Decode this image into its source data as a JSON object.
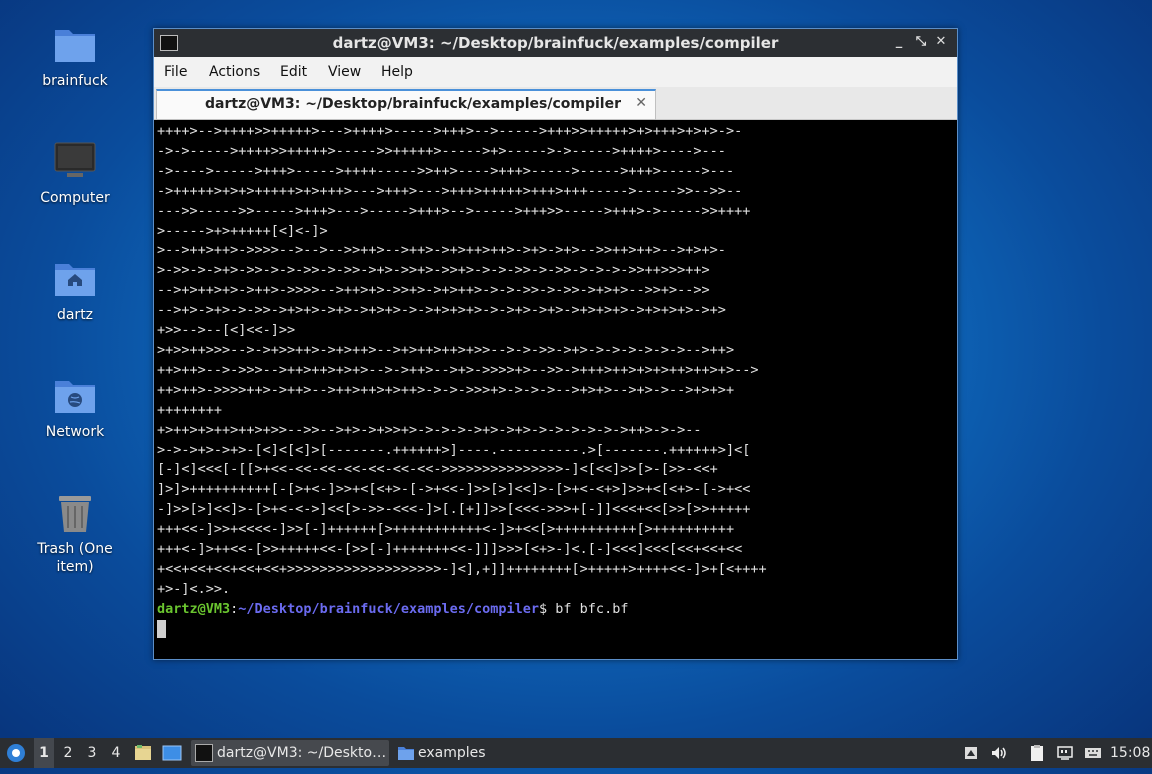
{
  "desktop": {
    "icons": [
      {
        "label": "brainfuck",
        "icon": "folder-icon"
      },
      {
        "label": "Computer",
        "icon": "computer-icon"
      },
      {
        "label": "dartz",
        "icon": "home-folder-icon"
      },
      {
        "label": "Network",
        "icon": "network-icon"
      },
      {
        "label": "Trash (One item)",
        "icon": "trash-icon"
      }
    ]
  },
  "window": {
    "title": "dartz@VM3: ~/Desktop/brainfuck/examples/compiler",
    "controls": {
      "minimize": "_",
      "maximize": "⤡",
      "close": "✕"
    },
    "menu": [
      "File",
      "Actions",
      "Edit",
      "View",
      "Help"
    ],
    "tab": {
      "label": "dartz@VM3: ~/Desktop/brainfuck/examples/compiler",
      "close": "✕"
    }
  },
  "terminal": {
    "lines": [
      "++++>-->++++>>+++++>--->++++>----->+++>-->----->+++>>+++++>+>+++>+>+>->-",
      "->->----->++++>>+++++>----->>+++++>----->+>----->->----->++++>---->---",
      "->---->----->+++>----->++++----->>++>---->+++>----->----->+++>----->---",
      "->+++++>+>+>+++++>+>+++>--->+++>--->+++>+++++>+++>+++----->----->>-->>--",
      "--->>----->>----->+++>--->----->+++>-->----->+++>>----->+++>->----->>++++",
      ">----->+>+++++[<]<-]>",
      ">-->++>++>->>>>-->-->-->>++>-->++>->+>++>++>->+>->+>-->>++>++>-->+>+>-",
      ">->>->->+>->>->->->>->->>->+>->>+>->>+>->->->>->->>->->->->>++>>>++>",
      "-->+>++>+>->++>->>>>-->++>+>->>+>->+>++>->->->>->->>->+>+>-->>+>-->>",
      "-->+>->+>->->>->+>+>->+>->+>+>->->+>+>+>->->+>->+>->+>+>+>->+>+>+>->+>",
      "+>>-->--[<]<<-]>>",
      ">+>>++>>>-->->+>>++>->+>++>-->+>++>++>+>>-->->->>->+>->->->->->->-->++>",
      "++>++>-->->>>-->++>++>+>+>-->->++>-->+>->>>>+>-->>->+++>++>+>+>++>++>+>-->",
      "++>++>->>>>++>->++>-->++>++>+>++>->->->>>+>->->->-->+>+>-->+>->-->+>+>+",
      "++++++++",
      "+>++>+>++>++>+>>-->>-->+>->+>>+>->->->->+>->+>->->->->->->++>->->--",
      ">->->+>->+>-[<]<[<]>[-------.++++++>]----.----------.>[-------.++++++>]<[",
      "[-]<]<<<[-[[>+<<-<<-<<-<<-<<-<<-<<->>>>>>>>>>>>>>>-]<[<<]>>[>-[>>-<<+",
      "]>]>++++++++++[-[>+<-]>>+<[<+>-[->+<<-]>>[>]<<]>-[>+<-<+>]>>+<[<+>-[->+<<",
      "-]>>[>]<<]>-[>+<-<->]<<[>->>-<<<-]>[.[+]]>>[<<<->>>+[-]]<<<+<<[>>[>>+++++",
      "+++<<-]>>+<<<<-]>>[-]++++++[>+++++++++++<-]>+<<[>++++++++++[>++++++++++",
      "+++<-]>++<<-[>>+++++<<-[>>[-]+++++++<<-]]]>>>[<+>-]<.[-]<<<]<<<[<<+<<+<<",
      "+<<+<<+<<+<<+<<+>>>>>>>>>>>>>>>>>>>-]<],+]]++++++++[>+++++>++++<<-]>+[<++++",
      "+>-]<.>>."
    ],
    "prompt_user": "dartz@VM3",
    "prompt_sep": ":",
    "prompt_path": "~/Desktop/brainfuck/examples/compiler",
    "prompt_end": "$ ",
    "command": "bf bfc.bf"
  },
  "taskbar": {
    "workspaces": [
      "1",
      "2",
      "3",
      "4"
    ],
    "tasks": [
      {
        "label": "dartz@VM3: ~/Deskto…",
        "icon": "terminal-icon"
      },
      {
        "label": "examples",
        "icon": "folder-icon"
      }
    ],
    "clock": "15:08"
  }
}
